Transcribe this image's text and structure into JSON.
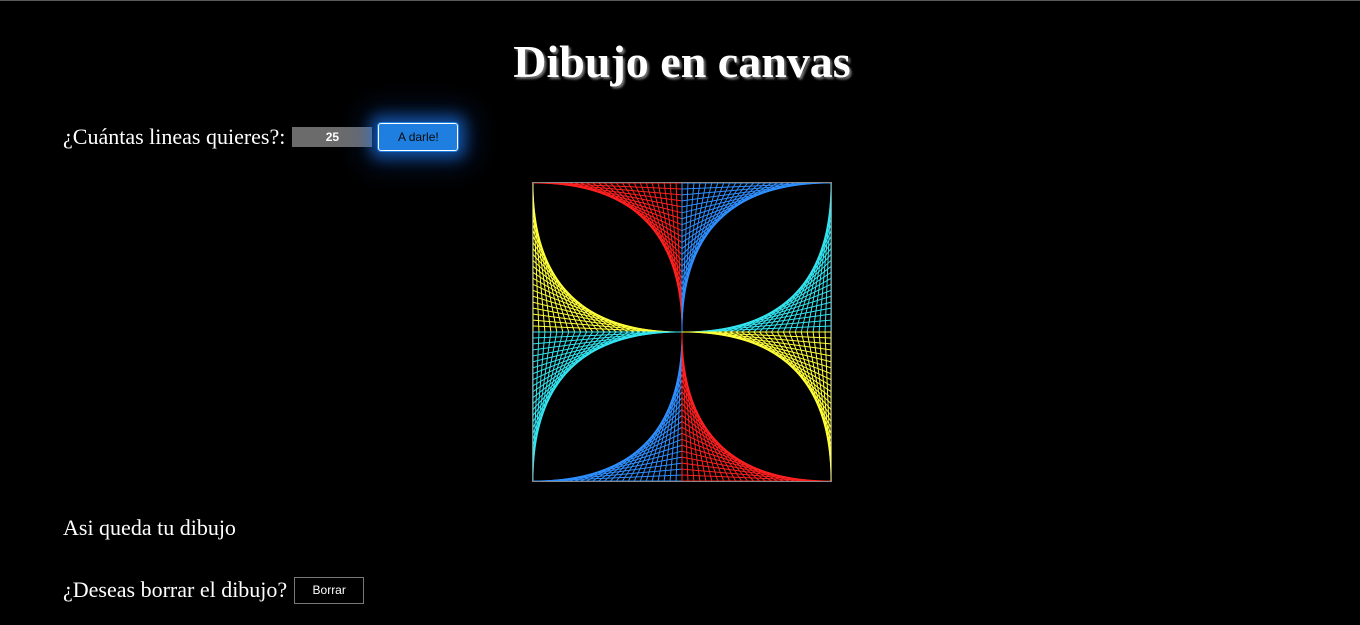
{
  "header": {
    "title": "Dibujo en canvas"
  },
  "controls": {
    "lines_label": "¿Cuántas lineas quieres?:",
    "lines_value": "25",
    "draw_button_label": "A darle!"
  },
  "drawing": {
    "line_count": 25,
    "colors": {
      "red": "#ff2020",
      "blue": "#2f8fff",
      "yellow": "#ffff3a",
      "cyan": "#33e5f0"
    }
  },
  "result": {
    "text": "Asi queda tu dibujo"
  },
  "erase": {
    "label": "¿Deseas borrar el dibujo?",
    "button_label": "Borrar"
  }
}
